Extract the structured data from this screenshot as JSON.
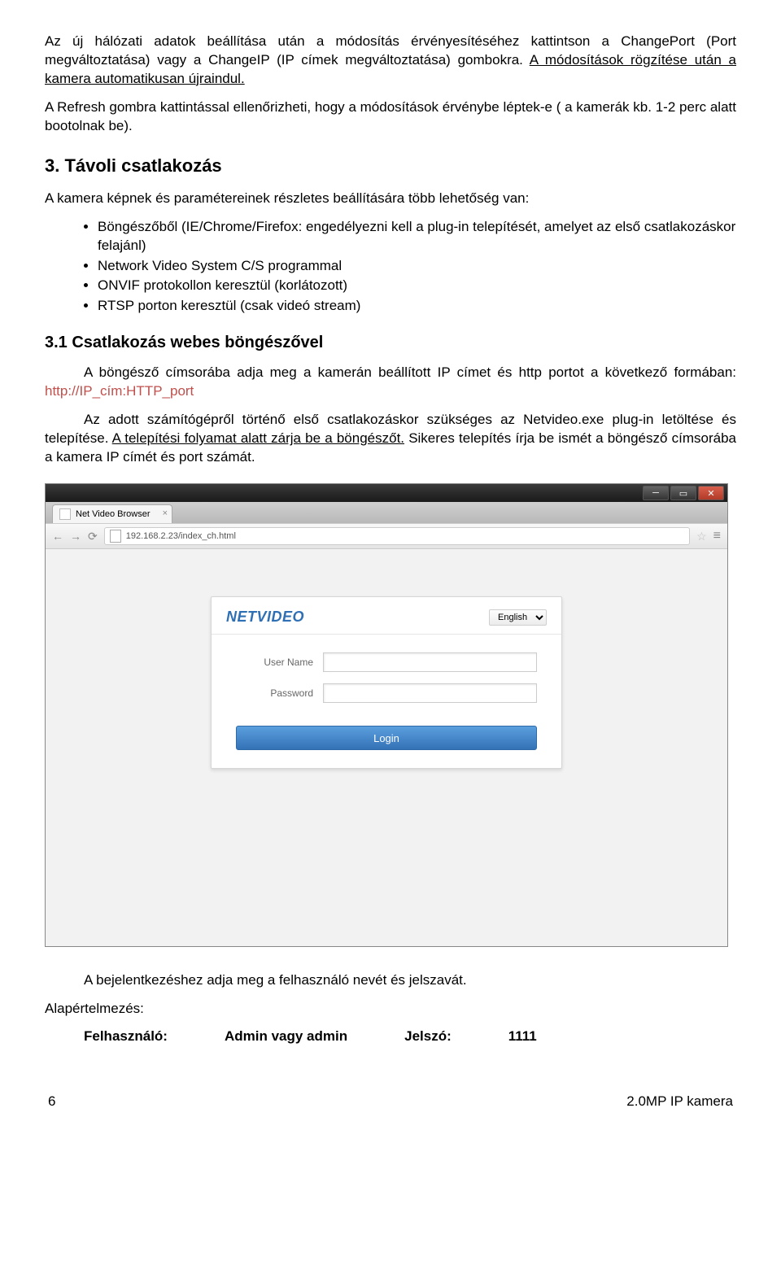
{
  "paragraphs": {
    "p1_a": "Az új hálózati adatok beállítása után a módosítás érvényesítéséhez kattintson a ChangePort (Port megváltoztatása) vagy a ChangeIP (IP címek megváltoztatása) gombokra. ",
    "p1_b": "A módosítások rögzítése után a kamera automatikusan újraindul.",
    "p2": "A Refresh gombra kattintással ellenőrizheti, hogy a módosítások érvénybe léptek-e ( a kamerák kb. 1-2 perc alatt bootolnak be).",
    "h2": "3. Távoli csatlakozás",
    "p3": "A kamera képnek és paramétereinek részletes beállítására több lehetőség van:",
    "bullets": [
      "Böngészőből (IE/Chrome/Firefox: engedélyezni kell a plug-in telepítését, amelyet az első csatlakozáskor felajánl)",
      "Network Video System C/S programmal",
      "ONVIF protokollon keresztül (korlátozott)",
      "RTSP porton keresztül (csak videó stream)"
    ],
    "h3": "3.1 Csatlakozás webes böngészővel",
    "p4_a": "A böngésző címsorába adja meg a kamerán beállított IP címet és http portot a következő formában: ",
    "p4_link": "http://IP_cím:HTTP_port",
    "p5_a": "Az adott számítógépről történő első csatlakozáskor szükséges az Netvideo.exe plug-in letöltése és telepítése. ",
    "p5_b": "A telepítési folyamat alatt zárja be a böngészőt.",
    "p5_c": " Sikeres telepítés írja be ismét a böngésző címsorába a kamera IP címét és port számát.",
    "p6": "A bejelentkezéshez adja meg a felhasználó nevét és jelszavát.",
    "p7": "Alapértelmezés:",
    "creds_user_label": "Felhasználó:",
    "creds_user_val": "Admin vagy admin",
    "creds_pass_label": "Jelszó:",
    "creds_pass_val": "1111"
  },
  "screenshot": {
    "tab_title": "Net Video Browser",
    "url": "192.168.2.23/index_ch.html",
    "brand": "NETVIDEO",
    "language": "English",
    "username_label": "User Name",
    "password_label": "Password",
    "login_button": "Login"
  },
  "footer": {
    "page_num": "6",
    "doc_title": "2.0MP IP kamera"
  }
}
